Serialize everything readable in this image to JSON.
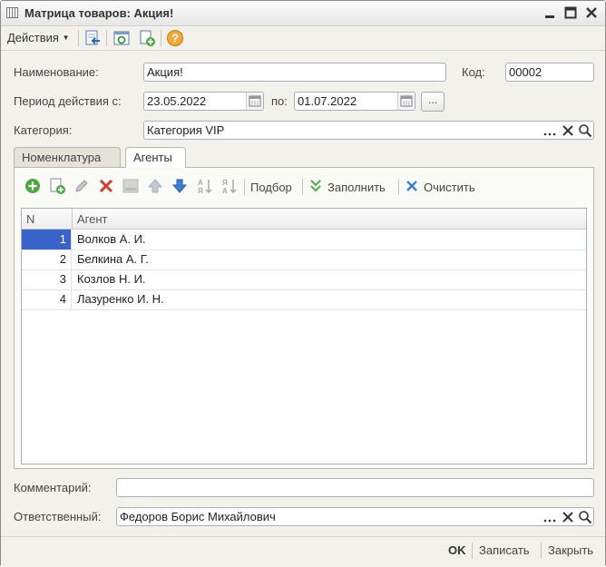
{
  "window": {
    "title": "Матрица товаров: Акция!"
  },
  "toolbar": {
    "actions_label": "Действия"
  },
  "form": {
    "name_label": "Наименование:",
    "name_value": "Акция!",
    "code_label": "Код:",
    "code_value": "00002",
    "period_label": "Период действия с:",
    "period_from": "23.05.2022",
    "period_to_label": "по:",
    "period_to": "01.07.2022",
    "period_more": "...",
    "category_label": "Категория:",
    "category_value": "Категория VIP",
    "comment_label": "Комментарий:",
    "comment_value": "",
    "responsible_label": "Ответственный:",
    "responsible_value": "Федоров Борис Михайлович"
  },
  "tabs": [
    {
      "label": "Номенклатура",
      "active": false
    },
    {
      "label": "Агенты",
      "active": true
    }
  ],
  "inner_toolbar": {
    "pick_label": "Подбор",
    "fill_label": "Заполнить",
    "clear_label": "Очистить"
  },
  "table": {
    "columns": [
      "N",
      "Агент"
    ],
    "rows": [
      {
        "n": "1",
        "agent": "Волков А. И.",
        "selected": true
      },
      {
        "n": "2",
        "agent": "Белкина А. Г."
      },
      {
        "n": "3",
        "agent": "Козлов Н. И."
      },
      {
        "n": "4",
        "agent": "Лазуренко И. Н."
      }
    ]
  },
  "footer": {
    "ok_label": "OK",
    "save_label": "Записать",
    "close_label": "Закрыть"
  },
  "colors": {
    "selection": "#3a63c9",
    "accent_green": "#4ca843",
    "accent_red": "#d23c2e",
    "accent_blue": "#3d7ed6"
  }
}
